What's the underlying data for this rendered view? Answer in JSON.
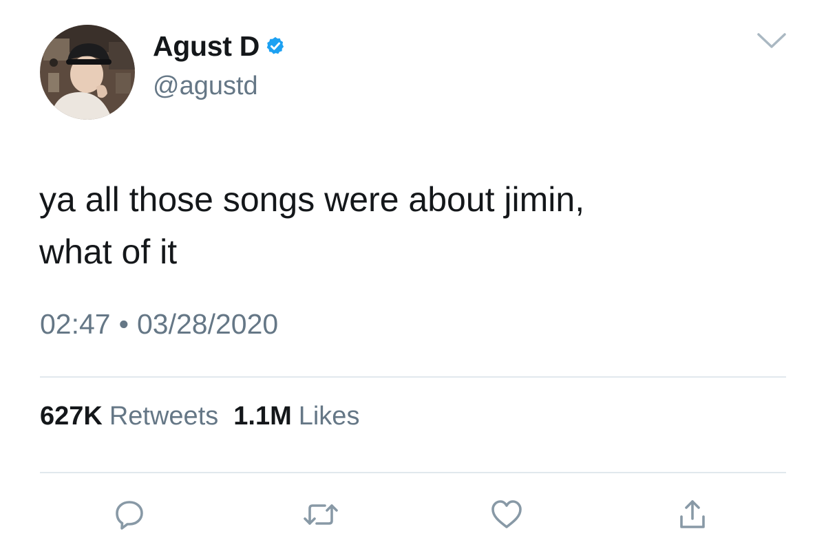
{
  "author": {
    "display_name": "Agust D",
    "handle": "@agustd",
    "verified": true,
    "verified_color": "#1da1f2"
  },
  "tweet": {
    "text_lines": [
      "ya all those songs were about jimin,",
      "what of it"
    ],
    "time": "02:47",
    "separator": "•",
    "date": "03/28/2020"
  },
  "stats": {
    "retweets_count": "627K",
    "retweets_label": "Retweets",
    "likes_count": "1.1M",
    "likes_label": "Likes"
  },
  "actions": [
    {
      "icon": "reply-icon"
    },
    {
      "icon": "retweet-icon"
    },
    {
      "icon": "heart-icon"
    },
    {
      "icon": "share-icon"
    }
  ],
  "colors": {
    "text_primary": "#14171a",
    "text_secondary": "#657786",
    "icon_gray": "#8899a6",
    "divider": "#e1e8ed"
  }
}
